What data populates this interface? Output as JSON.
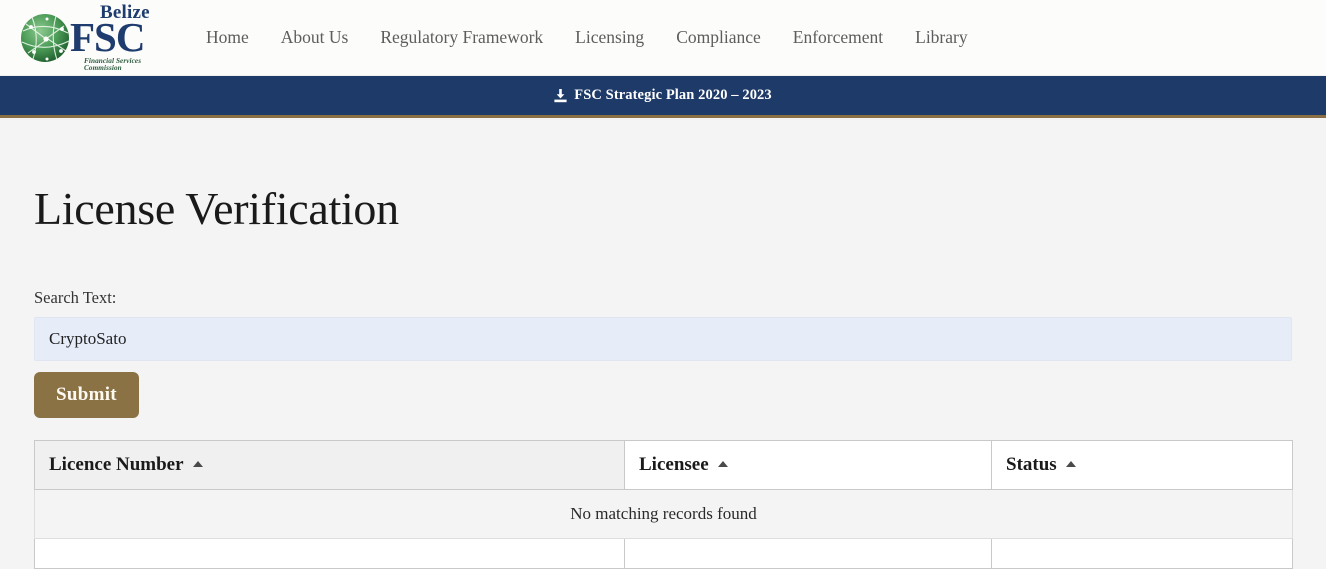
{
  "site": {
    "logo": {
      "brand_top": "Belize",
      "brand_main": "FSC",
      "brand_sub": "Financial Services Commission",
      "globe_icon": "globe-network-icon",
      "brand_color": "#1f3c6e",
      "globe_color": "#2f7a43"
    },
    "nav": [
      {
        "label": "Home"
      },
      {
        "label": "About Us"
      },
      {
        "label": "Regulatory Framework"
      },
      {
        "label": "Licensing"
      },
      {
        "label": "Compliance"
      },
      {
        "label": "Enforcement"
      },
      {
        "label": "Library"
      }
    ]
  },
  "banner": {
    "icon": "download-icon",
    "label": "FSC Strategic Plan 2020 – 2023",
    "background_color": "#1e3a68",
    "accent_color": "#8a6f45"
  },
  "page": {
    "title": "License Verification"
  },
  "search": {
    "label": "Search Text:",
    "value": "CryptoSato",
    "placeholder": "",
    "submit_label": "Submit",
    "submit_color": "#8b7245",
    "input_background": "#e6edf9"
  },
  "table": {
    "columns": [
      {
        "label": "Licence Number",
        "sort": "asc",
        "sorted": true
      },
      {
        "label": "Licensee",
        "sort": "asc",
        "sorted": false
      },
      {
        "label": "Status",
        "sort": "asc",
        "sorted": false
      }
    ],
    "rows": [],
    "empty_message": "No matching records found"
  }
}
